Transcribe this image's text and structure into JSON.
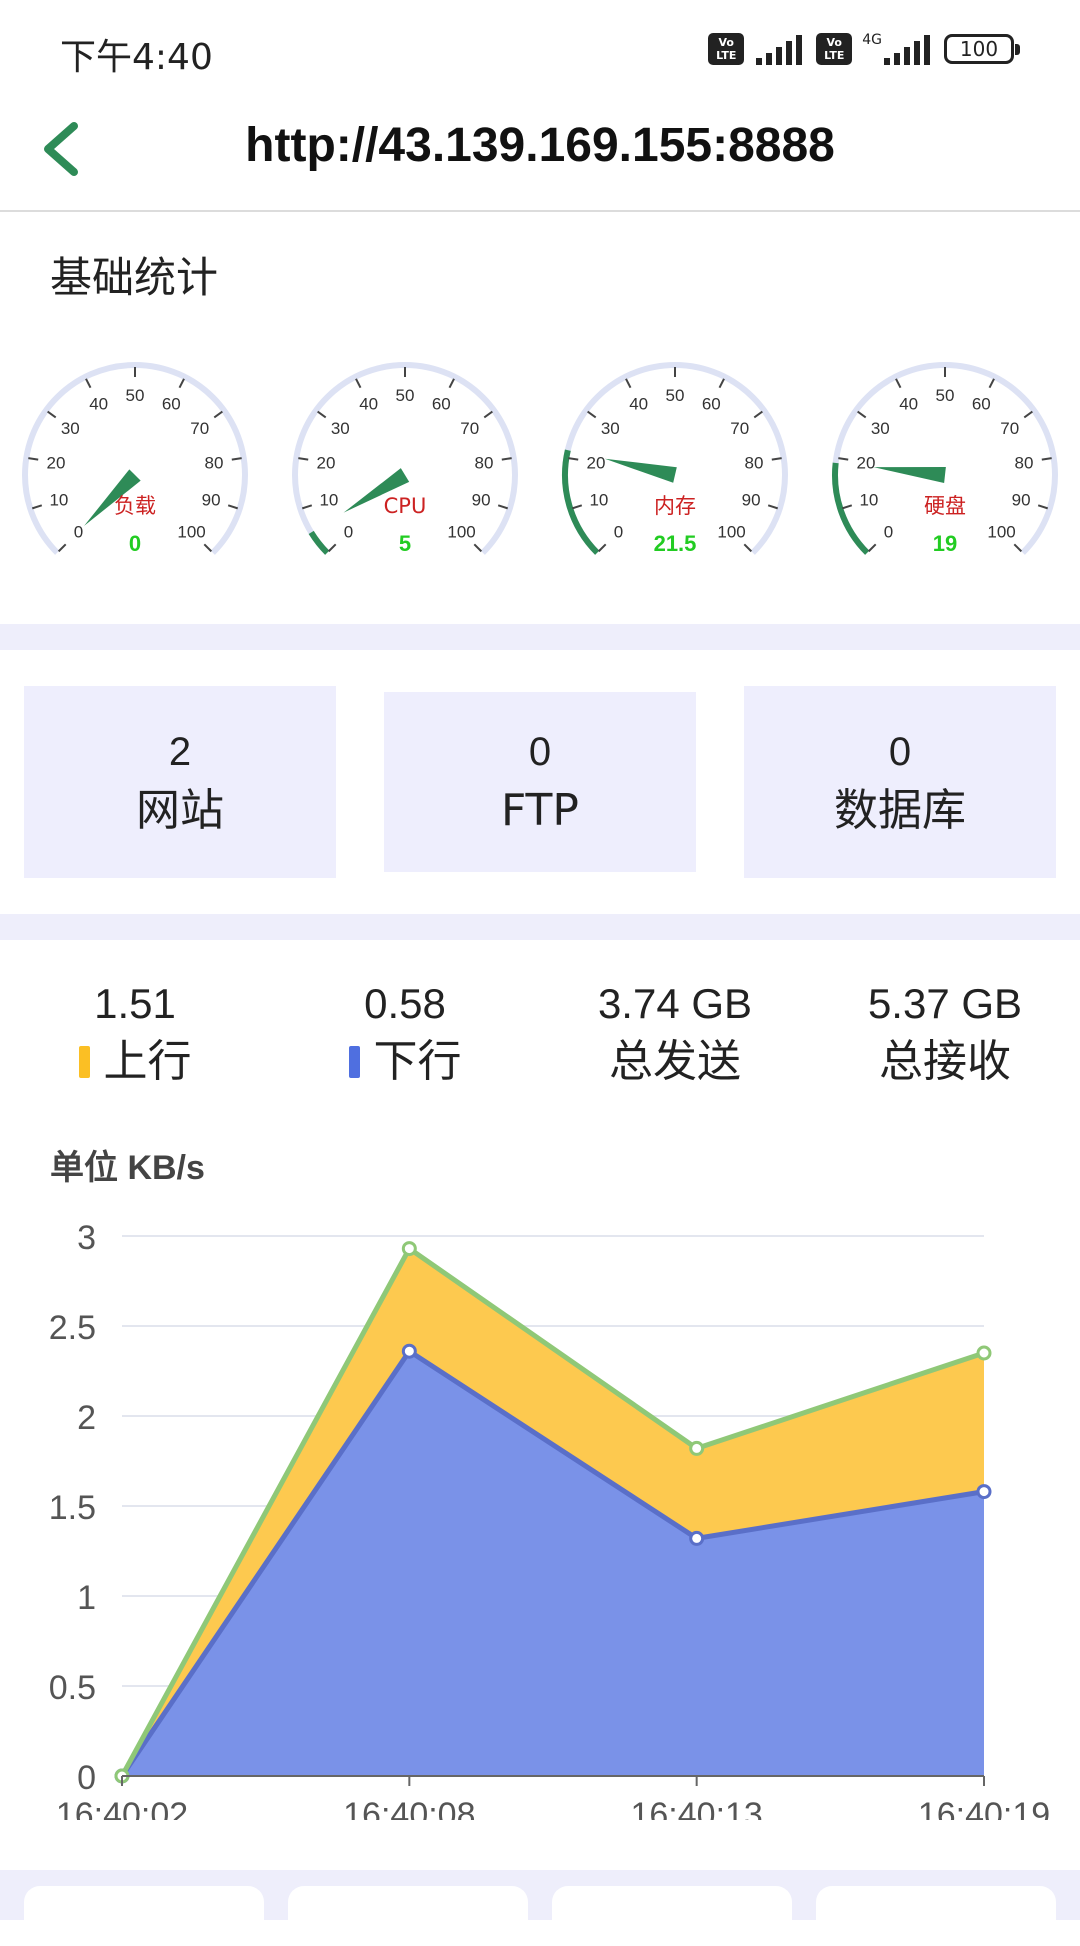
{
  "status_bar": {
    "time": "下午4:40",
    "network": "4G",
    "volte1": "Vo LTE",
    "volte2": "Vo LTE",
    "battery": "100"
  },
  "header": {
    "title": "http://43.139.169.155:8888"
  },
  "basic_stats": {
    "title": "基础统计",
    "gauges": [
      {
        "label": "负载",
        "value": "0",
        "percent": 0
      },
      {
        "label": "CPU",
        "value": "5",
        "percent": 5
      },
      {
        "label": "内存",
        "value": "21.5",
        "percent": 21.5
      },
      {
        "label": "硬盘",
        "value": "19",
        "percent": 19
      }
    ],
    "gauge_ticks": [
      "0",
      "10",
      "20",
      "30",
      "40",
      "50",
      "60",
      "70",
      "80",
      "90",
      "100"
    ]
  },
  "counts": [
    {
      "value": "2",
      "label": "网站"
    },
    {
      "value": "0",
      "label": "FTP"
    },
    {
      "value": "0",
      "label": "数据库"
    }
  ],
  "traffic": [
    {
      "value": "1.51",
      "label": "上行",
      "swatch": "#fbbf24"
    },
    {
      "value": "0.58",
      "label": "下行",
      "swatch": "#4f6fe0"
    },
    {
      "value": "3.74 GB",
      "label": "总发送",
      "swatch": ""
    },
    {
      "value": "5.37 GB",
      "label": "总接收",
      "swatch": ""
    }
  ],
  "chart_unit": "单位 KB/s",
  "colors": {
    "accent_green": "#2e8b57",
    "gauge_value_green": "#22cc22",
    "gauge_label_red": "#cc2222",
    "upstream_fill": "#fdc94f",
    "upstream_line": "#8fc877",
    "downstream_fill": "#7a92e8",
    "downstream_line": "#5a6fc8"
  },
  "chart_data": {
    "type": "area",
    "title": "",
    "xlabel": "",
    "ylabel": "单位 KB/s",
    "x": [
      "16:40:02",
      "16:40:08",
      "16:40:13",
      "16:40:19"
    ],
    "ylim": [
      0,
      3
    ],
    "yticks": [
      "0",
      "0.5",
      "1",
      "1.5",
      "2",
      "2.5",
      "3"
    ],
    "stacked": true,
    "grid": true,
    "series": [
      {
        "name": "下行",
        "values": [
          0,
          2.36,
          1.32,
          1.58
        ]
      },
      {
        "name": "上行",
        "values": [
          0,
          0.57,
          0.5,
          0.77
        ]
      }
    ]
  }
}
